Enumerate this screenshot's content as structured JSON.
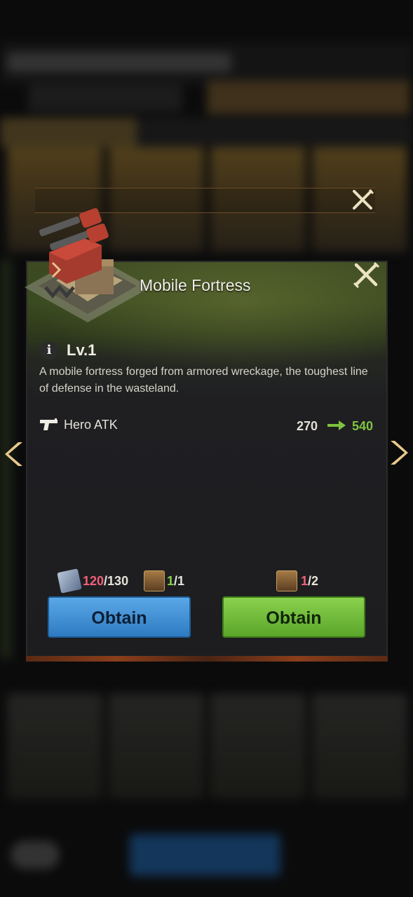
{
  "dialog": {
    "title": "Mobile Fortress",
    "level": "Lv.1",
    "description": "A mobile fortress forged from armored wreckage, the toughest line of defense in the wasteland.",
    "stat": {
      "label": "Hero ATK",
      "current": "270",
      "next": "540",
      "icon": "pistol-icon"
    },
    "cost_left": {
      "material_have": "120",
      "material_need": "/130",
      "material_icon": "chip-icon",
      "unit_have": "1",
      "unit_need": "/1",
      "unit_icon": "fortress-unit-icon"
    },
    "cost_right": {
      "unit_have": "1",
      "unit_need": "/2",
      "unit_icon": "fortress-unit-icon"
    },
    "buttons": {
      "left_label": "Obtain",
      "right_label": "Obtain"
    }
  },
  "colors": {
    "increase": "#7fc33f",
    "insufficient": "#f2607a",
    "enough": "#85d24a",
    "obtain_blue": "#3a8bd2",
    "obtain_green": "#6fbc38"
  }
}
